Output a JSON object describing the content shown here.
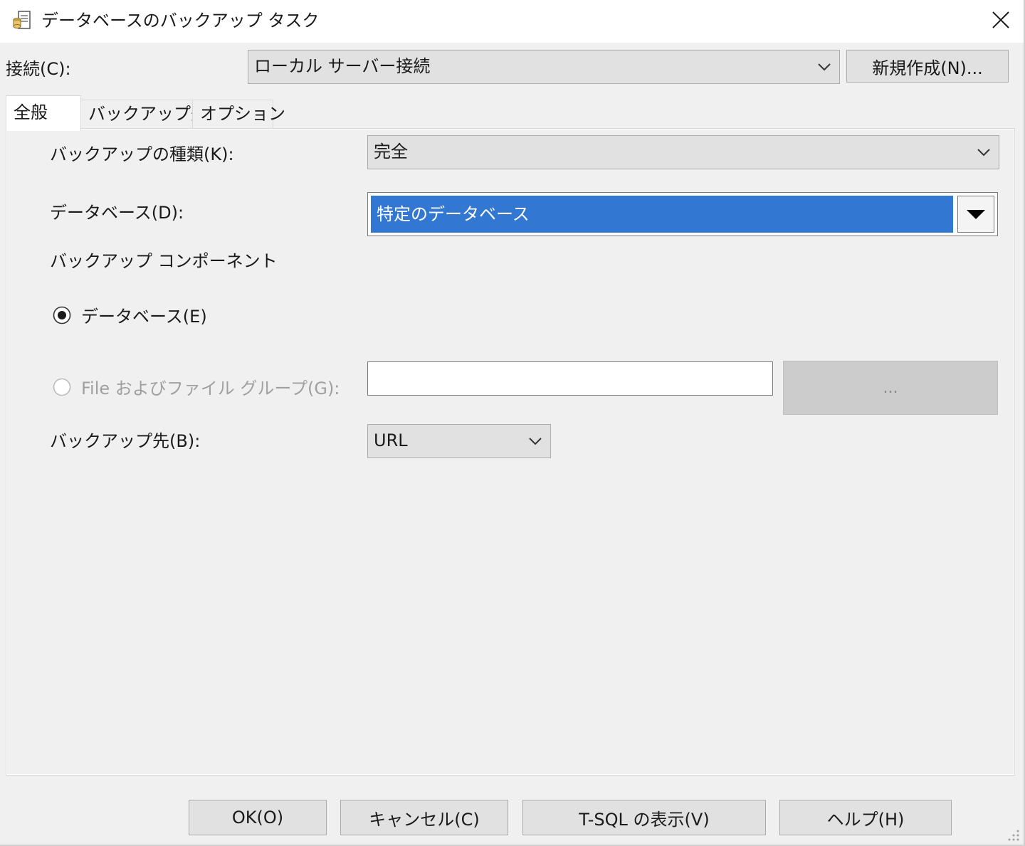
{
  "window": {
    "title": "データベースのバックアップ タスク",
    "icon": "backup-task-icon"
  },
  "connection": {
    "label": "接続(C):",
    "value": "ローカル サーバー接続",
    "new_button": "新規作成(N)..."
  },
  "tabs": [
    {
      "label": "全般",
      "active": true
    },
    {
      "label": "バックアップ先",
      "active": false
    },
    {
      "label": "オプション",
      "active": false
    }
  ],
  "general": {
    "backup_type_label": "バックアップの種類(K):",
    "backup_type_value": "完全",
    "database_label": "データベース(D):",
    "database_value": "特定のデータベース",
    "component_label": "バックアップ コンポーネント",
    "radio_database_label": "データベース(E)",
    "radio_database_checked": true,
    "radio_files_label": "File およびファイル グループ(G):",
    "radio_files_checked": false,
    "files_value": "",
    "browse_label": "...",
    "destination_label": "バックアップ先(B):",
    "destination_value": "URL"
  },
  "footer": {
    "ok": "OK(O)",
    "cancel": "キャンセル(C)",
    "tsql": "T-SQL の表示(V)",
    "help": "ヘルプ(H)"
  },
  "colors": {
    "selection": "#3277d1",
    "dialog_bg": "#f0f0f0",
    "button_bg": "#e1e1e1"
  }
}
